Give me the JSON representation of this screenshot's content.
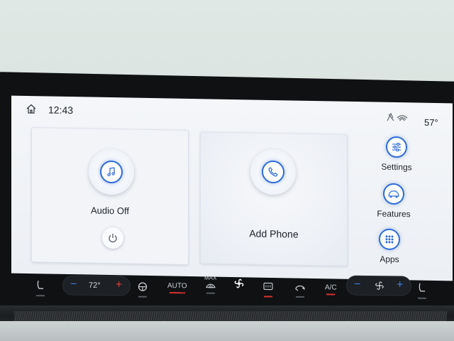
{
  "status_bar": {
    "time": "12:43",
    "outside_temp": "57°",
    "icons": [
      "home-icon",
      "no-gps-icon",
      "wifi-icon"
    ]
  },
  "tiles": {
    "audio": {
      "label": "Audio Off",
      "icon": "music-note-icon",
      "power_icon": "power-icon"
    },
    "phone": {
      "label": "Add Phone",
      "icon": "phone-icon"
    }
  },
  "side_buttons": [
    {
      "label": "Settings",
      "icon": "sliders-icon"
    },
    {
      "label": "Features",
      "icon": "car-icon"
    },
    {
      "label": "Apps",
      "icon": "grid-dots-icon"
    }
  ],
  "climate": {
    "seat_left_icon": "seat-heat-icon",
    "temp_minus": "−",
    "temp_set": "72°",
    "temp_plus": "+",
    "steering_heat_icon": "steering-wheel-heat-icon",
    "auto_label": "AUTO",
    "max_label": "MAX",
    "max_defrost_icon": "max-defrost-icon",
    "fan_auto_icon": "fan-icon",
    "rear_defrost_icon": "rear-defrost-icon",
    "recirc_icon": "recirculation-icon",
    "ac_label": "A/C",
    "fan_minus": "−",
    "fan_plus": "+",
    "seat_right_icon": "seat-heat-icon"
  },
  "colors": {
    "accent": "#2f6cd8",
    "warm": "#e3403a",
    "cool": "#3c7fe6"
  }
}
